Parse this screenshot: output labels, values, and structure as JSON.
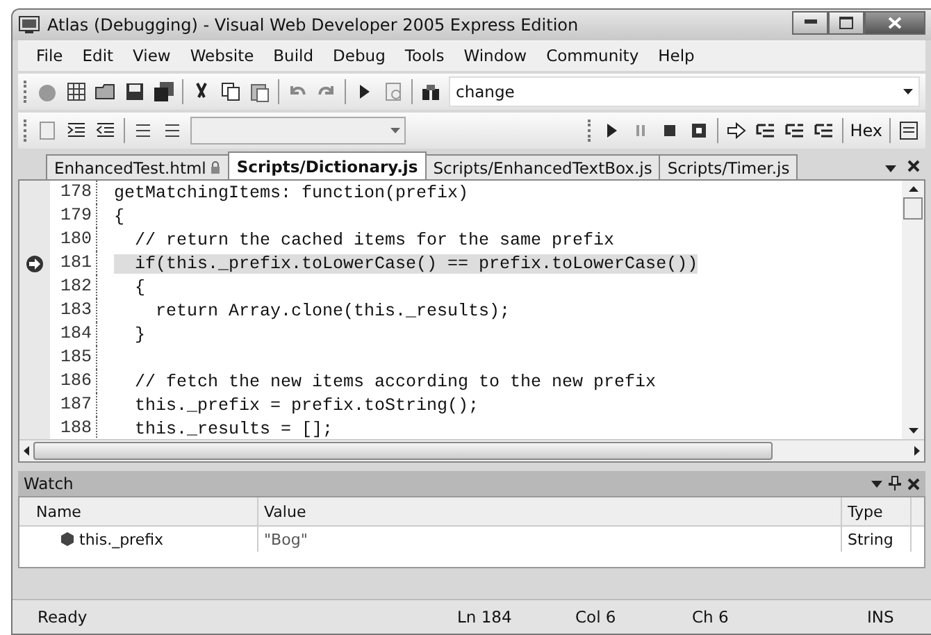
{
  "window": {
    "title": "Atlas (Debugging) - Visual Web Developer 2005 Express Edition"
  },
  "menu": [
    "File",
    "Edit",
    "View",
    "Website",
    "Build",
    "Debug",
    "Tools",
    "Window",
    "Community",
    "Help"
  ],
  "toolbar": {
    "find_value": "change",
    "hex_label": "Hex"
  },
  "tabs": [
    {
      "label": "EnhancedTest.html",
      "selected": false,
      "locked": true
    },
    {
      "label": "Scripts/Dictionary.js",
      "selected": true,
      "locked": false
    },
    {
      "label": "Scripts/EnhancedTextBox.js",
      "selected": false,
      "locked": false
    },
    {
      "label": "Scripts/Timer.js",
      "selected": false,
      "locked": false
    }
  ],
  "code": [
    {
      "number": "178",
      "text": "getMatchingItems: function(prefix)",
      "current": false
    },
    {
      "number": "179",
      "text": "{",
      "current": false
    },
    {
      "number": "180",
      "text": "  // return the cached items for the same prefix",
      "current": false
    },
    {
      "number": "181",
      "text": "  if(this._prefix.toLowerCase() == prefix.toLowerCase())",
      "current": true
    },
    {
      "number": "182",
      "text": "  {",
      "current": false
    },
    {
      "number": "183",
      "text": "    return Array.clone(this._results);",
      "current": false
    },
    {
      "number": "184",
      "text": "  }",
      "current": false
    },
    {
      "number": "185",
      "current": false
    },
    {
      "number": "186",
      "text": "  // fetch the new items according to the new prefix",
      "current": false
    },
    {
      "number": "187",
      "text": "  this._prefix = prefix.toString();",
      "current": false
    },
    {
      "number": "188",
      "text": "  this._results = [];",
      "current": false
    }
  ],
  "watch": {
    "title": "Watch",
    "columns": [
      "Name",
      "Value",
      "Type"
    ],
    "rows": [
      {
        "name": "this._prefix",
        "value": "\"Bog\"",
        "type": "String"
      }
    ]
  },
  "status_bar": {
    "message": "Ready",
    "line": "Ln 184",
    "column": "Col 6",
    "char": "Ch 6",
    "mode": "INS"
  }
}
